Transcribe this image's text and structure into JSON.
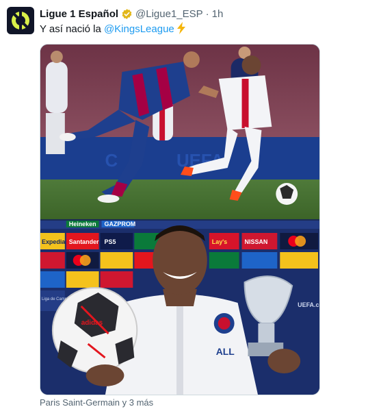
{
  "author": {
    "display_name": "Ligue 1 Español",
    "handle": "@Ligue1_ESP",
    "separator": "·",
    "time": "1h",
    "verified_badge": "gold-verified-icon",
    "avatar_icon": "ligue1-logo-icon"
  },
  "tweet": {
    "text_prefix": "Y así nació la ",
    "mention": "@KingsLeague",
    "emoji": "lightning-bolt-icon"
  },
  "media": {
    "top_photo": "match-action-photo",
    "bottom_photo": "player-trophy-photo",
    "board_sponsors": [
      "Heineken",
      "GAZPROM",
      "Expedia",
      "Santander",
      "PS5",
      "Lay's",
      "NISSAN",
      "Mastercard"
    ],
    "board_small_text": "Liga de Campeones",
    "trophy_label": "UEFA.com",
    "ball_brand": "adidas",
    "club_crest_text": "PARIS",
    "shirt_sponsor": "ALL"
  },
  "tagged_users": "Paris Saint-Germain y 3 más",
  "colors": {
    "link": "#1d9bf0",
    "secondary_text": "#536471",
    "border": "#cfd9de",
    "verified_gold": "#e2b719"
  }
}
